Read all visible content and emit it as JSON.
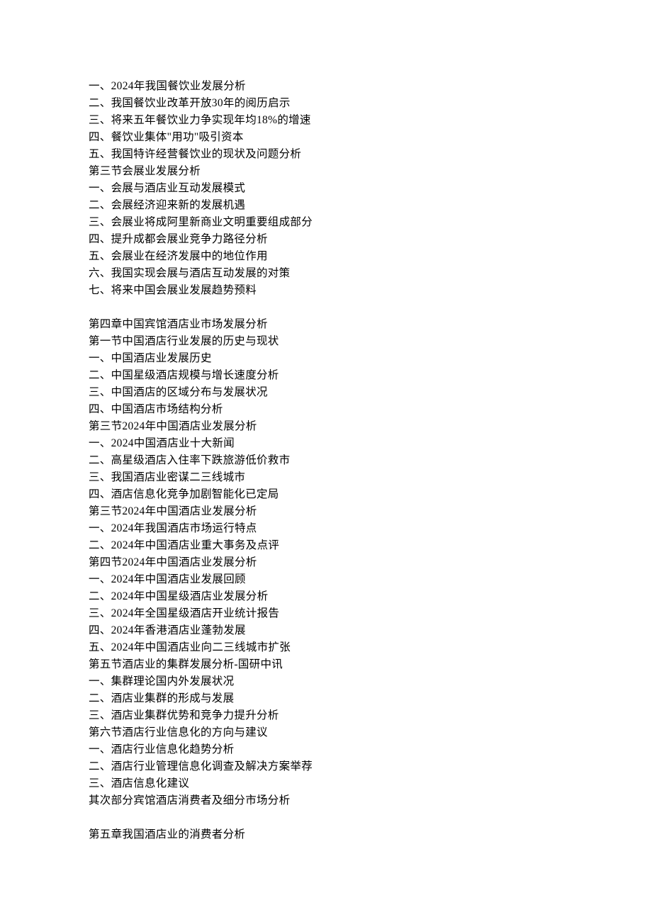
{
  "lines": [
    "一、2024年我国餐饮业发展分析",
    "二、我国餐饮业改革开放30年的阅历启示",
    "三、将来五年餐饮业力争实现年均18%的增速",
    "四、餐饮业集体\"用功\"吸引资本",
    "五、我国特许经营餐饮业的现状及问题分析",
    "第三节会展业发展分析",
    "一、会展与酒店业互动发展模式",
    "二、会展经济迎来新的发展机遇",
    "三、会展业将成阿里新商业文明重要组成部分",
    "四、提升成都会展业竞争力路径分析",
    "五、会展业在经济发展中的地位作用",
    "六、我国实现会展与酒店互动发展的对策",
    "七、将来中国会展业发展趋势预料",
    "",
    "第四章中国宾馆酒店业市场发展分析",
    "第一节中国酒店行业发展的历史与现状",
    "一、中国酒店业发展历史",
    "二、中国星级酒店规模与增长速度分析",
    "三、中国酒店的区域分布与发展状况",
    "四、中国酒店市场结构分析",
    "第三节2024年中国酒店业发展分析",
    "一、2024中国酒店业十大新闻",
    "二、高星级酒店入住率下跌旅游低价救市",
    "三、我国酒店业密谋二三线城市",
    "四、酒店信息化竞争加剧智能化已定局",
    "第三节2024年中国酒店业发展分析",
    "一、2024年我国酒店市场运行特点",
    "二、2024年中国酒店业重大事务及点评",
    "第四节2024年中国酒店业发展分析",
    "一、2024年中国酒店业发展回顾",
    "二、2024年中国星级酒店业发展分析",
    "三、2024年全国星级酒店开业统计报告",
    "四、2024年香港酒店业蓬勃发展",
    "五、2024年中国酒店业向二三线城市扩张",
    "第五节酒店业的集群发展分析-国研中讯",
    "一、集群理论国内外发展状况",
    "二、酒店业集群的形成与发展",
    "三、酒店业集群优势和竞争力提升分析",
    "第六节酒店行业信息化的方向与建议",
    "一、酒店行业信息化趋势分析",
    "二、酒店行业管理信息化调查及解决方案举荐",
    "三、酒店信息化建议",
    "其次部分宾馆酒店消费者及细分市场分析",
    "",
    "第五章我国酒店业的消费者分析"
  ]
}
